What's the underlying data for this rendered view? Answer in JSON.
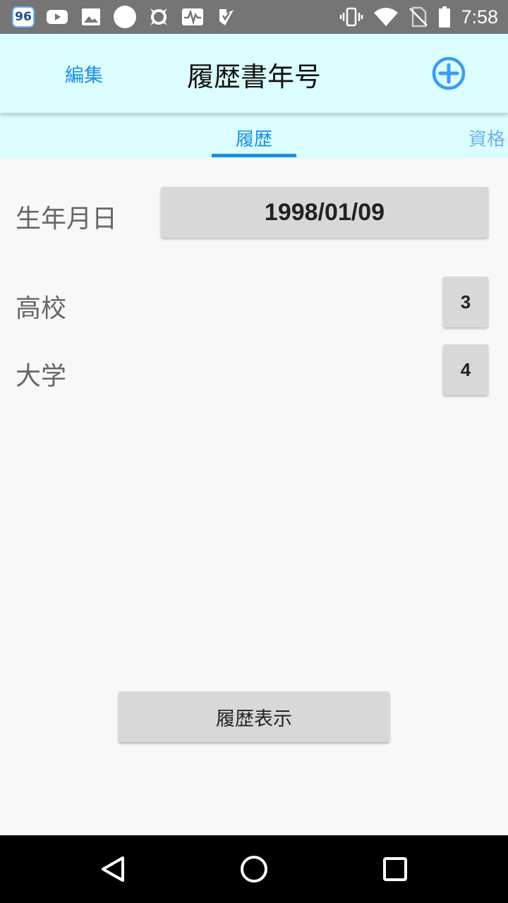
{
  "status_bar": {
    "badge": "96",
    "time": "7:58",
    "icons": [
      "badge-96-icon",
      "youtube-icon",
      "image-icon",
      "circle-icon",
      "avast-icon",
      "activity-icon",
      "check-app-icon",
      "vibrate-icon",
      "wifi-icon",
      "no-sim-icon",
      "battery-icon"
    ]
  },
  "app_bar": {
    "edit_label": "編集",
    "title": "履歴書年号",
    "add_icon": "plus-circle-icon",
    "accent_color": "#1a8fe6",
    "background": "#dcfdfd"
  },
  "tabs": [
    {
      "label": "履歴",
      "active": true
    },
    {
      "label": "資格",
      "active": false
    }
  ],
  "form": {
    "birthdate_label": "生年月日",
    "birthdate_value": "1998/01/09",
    "high_school_label": "高校",
    "high_school_years": "3",
    "university_label": "大学",
    "university_years": "4"
  },
  "show_history_label": "履歴表示",
  "nav_bar": {
    "icons": [
      "back-icon",
      "home-icon",
      "recents-icon"
    ]
  }
}
